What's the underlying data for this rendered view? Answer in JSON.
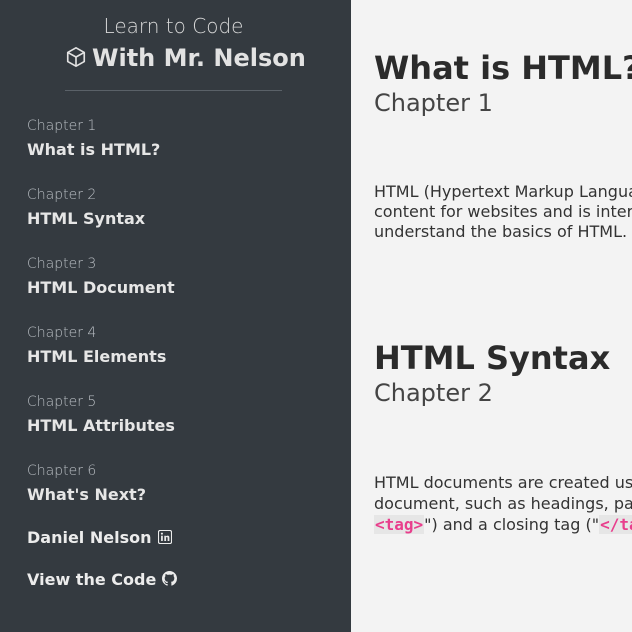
{
  "sidebar": {
    "brand_sub": "Learn to Code",
    "brand_main": "With Mr. Nelson",
    "brand_icon": "cube-icon",
    "items": [
      {
        "chapter": "Chapter 1",
        "title": "What is HTML?"
      },
      {
        "chapter": "Chapter 2",
        "title": "HTML Syntax"
      },
      {
        "chapter": "Chapter 3",
        "title": "HTML Document"
      },
      {
        "chapter": "Chapter 4",
        "title": "HTML Elements"
      },
      {
        "chapter": "Chapter 5",
        "title": "HTML Attributes"
      },
      {
        "chapter": "Chapter 6",
        "title": "What's Next?"
      }
    ],
    "author": {
      "label": "Daniel Nelson",
      "icon": "linkedin-icon"
    },
    "code_link": {
      "label": "View the Code",
      "icon": "github-icon"
    }
  },
  "main": {
    "sections": [
      {
        "title": "What is HTML?",
        "chapter": "Chapter 1",
        "body_lines": [
          "HTML (Hypertext Markup Language) is the standard markup language used to create",
          "content for websites and is interpreted by web browsers. This lesson will help you",
          "understand the basics of HTML."
        ]
      },
      {
        "title": "HTML Syntax",
        "chapter": "Chapter 2",
        "body_line1": "HTML documents are created using elements that describe the structure of the",
        "body_line2": "document, such as headings, paragraphs, and lists. Elements have an opening tag (\"",
        "body_line3_pre": "",
        "code_open": "<tag>",
        "body_line3_mid": "\") and a closing tag (\"",
        "code_close": "</tag>",
        "body_line3_post": "\")."
      }
    ]
  },
  "colors": {
    "sidebar_bg": "#343a40",
    "main_bg": "#f3f3f3",
    "code_color": "#e83e8c"
  }
}
